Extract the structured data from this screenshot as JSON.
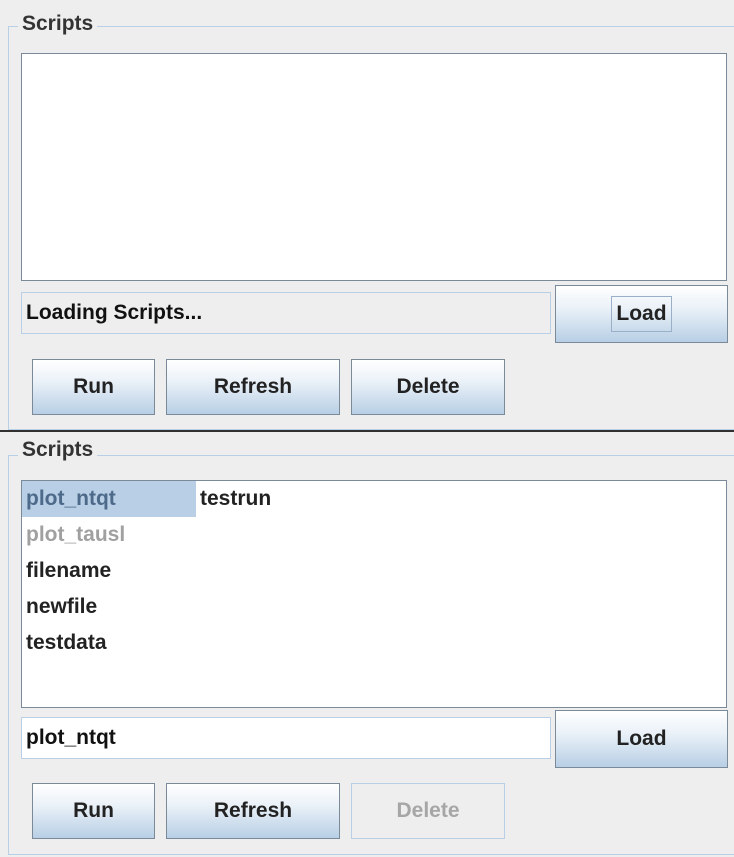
{
  "top_panel": {
    "title": "Scripts",
    "items": [],
    "status_text": "Loading Scripts...",
    "load_label": "Load",
    "run_label": "Run",
    "refresh_label": "Refresh",
    "delete_label": "Delete"
  },
  "bottom_panel": {
    "title": "Scripts",
    "items": [
      {
        "label": "plot_ntqt",
        "selected": true
      },
      {
        "label": "testrun"
      },
      {
        "label": "plot_tausl",
        "dimmed": true
      },
      {
        "label": "filename"
      },
      {
        "label": "newfile"
      },
      {
        "label": "testdata"
      }
    ],
    "input_value": "plot_ntqt",
    "load_label": "Load",
    "run_label": "Run",
    "refresh_label": "Refresh",
    "delete_label": "Delete",
    "delete_disabled": true
  },
  "colors": {
    "panel_bg": "#eeeeee",
    "selection_bg": "#b8cfe5",
    "selection_fg": "#4d6a8a",
    "disabled_fg": "#a6a6a6"
  }
}
